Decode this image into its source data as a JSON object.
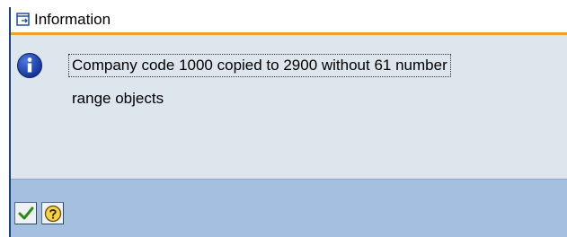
{
  "dialog": {
    "title": "Information",
    "title_icon": "window-icon",
    "message_icon": "info-icon",
    "message_line1": "Company code 1000 copied to 2900 without 61 number",
    "message_line2": "range objects"
  },
  "toolbar": {
    "buttons": [
      {
        "icon": "checkmark-icon",
        "action": "continue"
      },
      {
        "icon": "help-icon",
        "action": "help"
      }
    ]
  },
  "colors": {
    "accent_rule": "#f0a030",
    "content_bg": "#dde5ed",
    "toolbar_bg": "#a4bfe0",
    "info_icon": "#1a3fa0"
  }
}
